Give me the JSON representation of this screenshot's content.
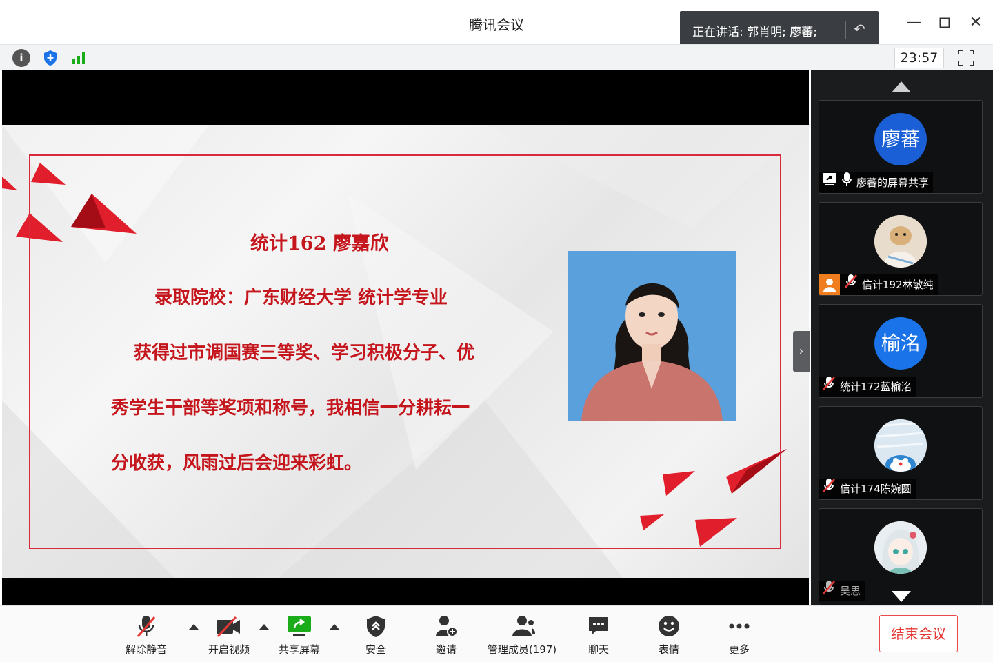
{
  "window": {
    "title": "腾讯会议",
    "speaking_label": "正在讲话: 郭肖明; 廖蕃;"
  },
  "infobar": {
    "timer": "23:57"
  },
  "slide": {
    "heading": "统计162 廖嘉欣",
    "line1": "录取院校：广东财经大学  统计学专业",
    "line2": "获得过市调国赛三等奖、学习积极分子、优",
    "line3": "秀学生干部等奖项和称号，我相信一分耕耘一",
    "line4": "分收获，风雨过后会迎来彩虹。"
  },
  "participants": [
    {
      "avatar_text": "廖蕃",
      "name": "廖蕃的屏幕共享",
      "avatar_color": "#1a5fd6"
    },
    {
      "avatar_text": "",
      "name": "信计192林敏纯",
      "avatar_color": "#e8dccd"
    },
    {
      "avatar_text": "榆洺",
      "name": "统计172蓝榆洺",
      "avatar_color": "#1a73e8"
    },
    {
      "avatar_text": "",
      "name": "信计174陈婉圆",
      "avatar_color": "#cfe0ec"
    },
    {
      "avatar_text": "",
      "name": "吴思",
      "avatar_color": "#d9e4ea"
    }
  ],
  "toolbar": {
    "unmute": "解除静音",
    "start_video": "开启视频",
    "share_screen": "共享屏幕",
    "security": "安全",
    "invite": "邀请",
    "manage_members": "管理成员(197)",
    "chat": "聊天",
    "reactions": "表情",
    "more": "更多",
    "end_meeting": "结束会议"
  },
  "colors": {
    "accent_red": "#e53935",
    "slide_red": "#c4161c",
    "share_green": "#1aad19"
  }
}
